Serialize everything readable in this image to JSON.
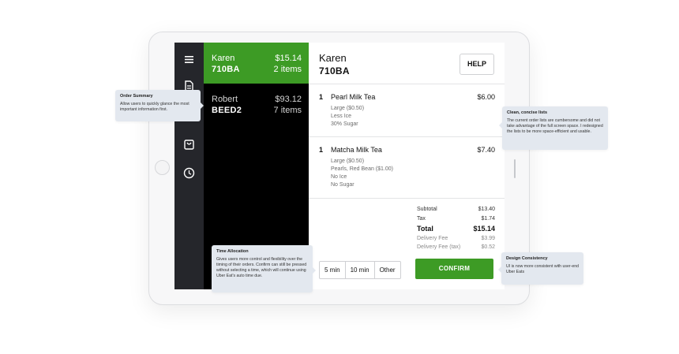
{
  "orders": [
    {
      "name": "Karen",
      "code": "710BA",
      "price": "$15.14",
      "items": "2 items"
    },
    {
      "name": "Robert",
      "code": "BEED2",
      "price": "$93.12",
      "items": "7 items"
    }
  ],
  "rail_icons": [
    "menu-icon",
    "document-icon",
    "shopping-bag-icon",
    "clock-icon"
  ],
  "detail": {
    "name": "Karen",
    "code": "710BA",
    "help_label": "HELP",
    "items": [
      {
        "qty": "1",
        "name": "Pearl Milk Tea",
        "price": "$6.00",
        "mods": [
          "Large ($0.50)",
          "Less Ice",
          "30% Sugar"
        ]
      },
      {
        "qty": "1",
        "name": "Matcha Milk Tea",
        "price": "$7.40",
        "mods": [
          "Large ($0.50)",
          "Pearls, Red Bean ($1.00)",
          "No Ice",
          "No Sugar"
        ]
      }
    ],
    "totals": {
      "subtotal_label": "Subtotal",
      "subtotal": "$13.40",
      "tax_label": "Tax",
      "tax": "$1.74",
      "total_label": "Total",
      "total": "$15.14",
      "delivery_label": "Delivery Fee",
      "delivery": "$3.99",
      "delivery_tax_label": "Delivery Fee (tax)",
      "delivery_tax": "$0.52"
    },
    "time_options": [
      "5 min",
      "10 min",
      "Other"
    ],
    "confirm_label": "CONFIRM"
  },
  "annotations": {
    "order_summary": {
      "title": "Order Summary",
      "body": "Allow users to quickly glance the most important information first."
    },
    "clean_lists": {
      "title": "Clean, concise lists",
      "body": "The current order lists are cumbersome and did not take advantage of the full screen space. I redesigned the lists to be more space-efficient and usable."
    },
    "time_allocation": {
      "title": "Time Allocation",
      "body": "Gives users more control and flexibility over the timing of their orders. Confirm can still be pressed without selecting a time, which will continue using Uber Eat's auto time due."
    },
    "design_consistency": {
      "title": "Design Consistency",
      "body": "UI is now more consistent with user-end Uber Eats"
    }
  },
  "colors": {
    "accent_green": "#3d9b25",
    "rail_dark": "#25262b",
    "orders_bg": "#000000",
    "note_bg": "#e3e8ef"
  }
}
